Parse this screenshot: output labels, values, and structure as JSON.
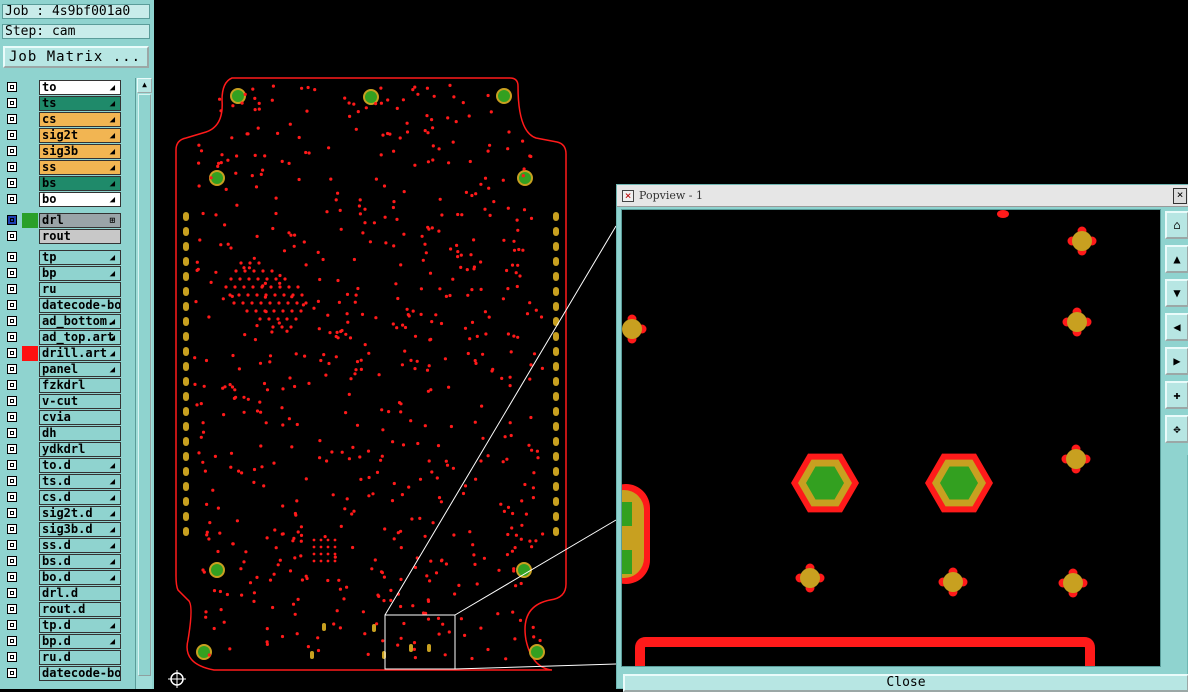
{
  "job": {
    "job_label": "Job : 4s9bf001a0",
    "step_label": "Step: cam",
    "matrix_button": "Job Matrix ..."
  },
  "layers": [
    {
      "name": "to",
      "color": "#ffffff",
      "mark": "◢"
    },
    {
      "name": "ts",
      "color": "#1f8a6a",
      "mark": "◢"
    },
    {
      "name": "cs",
      "color": "#f2b552",
      "mark": "◢"
    },
    {
      "name": "sig2t",
      "color": "#f2b552",
      "mark": "◢"
    },
    {
      "name": "sig3b",
      "color": "#f2b552",
      "mark": "◢"
    },
    {
      "name": "ss",
      "color": "#f2b552",
      "mark": "◢"
    },
    {
      "name": "bs",
      "color": "#1f8a6a",
      "mark": "◢"
    },
    {
      "name": "bo",
      "color": "#ffffff",
      "mark": "◢"
    },
    {
      "name": "drl",
      "color": "#9aa4a8",
      "mark": "⊞"
    },
    {
      "name": "rout",
      "color": "#c8c8c8",
      "mark": ""
    },
    {
      "name": "tp",
      "color": "#8fd3cf",
      "mark": "◢"
    },
    {
      "name": "bp",
      "color": "#8fd3cf",
      "mark": "◢"
    },
    {
      "name": "ru",
      "color": "#8fd3cf",
      "mark": ""
    },
    {
      "name": "datecode-bo",
      "color": "#8fd3cf",
      "mark": ""
    },
    {
      "name": "ad_bottom.",
      "color": "#8fd3cf",
      "mark": "◢"
    },
    {
      "name": "ad_top.art",
      "color": "#8fd3cf",
      "mark": "◢"
    },
    {
      "name": "drill.art",
      "color": "#8fd3cf",
      "mark": "◢"
    },
    {
      "name": "panel",
      "color": "#8fd3cf",
      "mark": "◢"
    },
    {
      "name": "fzkdrl",
      "color": "#8fd3cf",
      "mark": ""
    },
    {
      "name": "v-cut",
      "color": "#8fd3cf",
      "mark": ""
    },
    {
      "name": "cvia",
      "color": "#8fd3cf",
      "mark": ""
    },
    {
      "name": "dh",
      "color": "#8fd3cf",
      "mark": ""
    },
    {
      "name": "ydkdrl",
      "color": "#8fd3cf",
      "mark": ""
    },
    {
      "name": "to.d",
      "color": "#8fd3cf",
      "mark": "◢"
    },
    {
      "name": "ts.d",
      "color": "#8fd3cf",
      "mark": "◢"
    },
    {
      "name": "cs.d",
      "color": "#8fd3cf",
      "mark": "◢"
    },
    {
      "name": "sig2t.d",
      "color": "#8fd3cf",
      "mark": "◢"
    },
    {
      "name": "sig3b.d",
      "color": "#8fd3cf",
      "mark": "◢"
    },
    {
      "name": "ss.d",
      "color": "#8fd3cf",
      "mark": "◢"
    },
    {
      "name": "bs.d",
      "color": "#8fd3cf",
      "mark": "◢"
    },
    {
      "name": "bo.d",
      "color": "#8fd3cf",
      "mark": "◢"
    },
    {
      "name": "drl.d",
      "color": "#8fd3cf",
      "mark": ""
    },
    {
      "name": "rout.d",
      "color": "#8fd3cf",
      "mark": ""
    },
    {
      "name": "tp.d",
      "color": "#8fd3cf",
      "mark": "◢"
    },
    {
      "name": "bp.d",
      "color": "#8fd3cf",
      "mark": "◢"
    },
    {
      "name": "ru.d",
      "color": "#8fd3cf",
      "mark": ""
    },
    {
      "name": "datecode-bo",
      "color": "#8fd3cf",
      "mark": ""
    }
  ],
  "colors": {
    "outline": "#ff1a1a",
    "pad": "#c8a020",
    "drill": "#33a020",
    "board_bg": "#000000",
    "panel_bg": "#8fd3cf"
  },
  "popview": {
    "title": "Popview - 1",
    "close_label": "Close"
  },
  "icons": {
    "tools": [
      "zoom-home-icon",
      "pan-up-icon",
      "pan-down-icon",
      "pan-left-icon",
      "pan-right-icon",
      "zoom-in-icon",
      "zoom-out-icon"
    ],
    "origin": "origin-crosshair-icon"
  }
}
